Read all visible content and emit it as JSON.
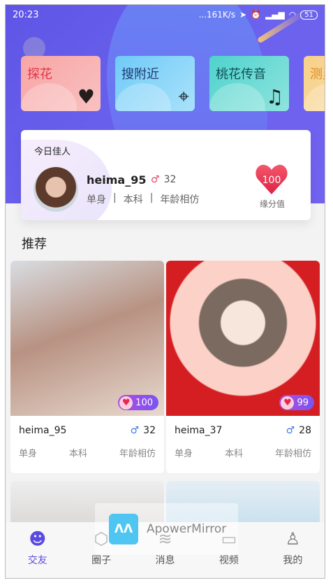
{
  "status": {
    "time": "20:23",
    "speed": "...161K/s",
    "battery": "51"
  },
  "categories": [
    {
      "label": "探花",
      "color": "#e0344a",
      "bg": "linear-gradient(135deg,#f7a5a5,#f9c1c0)"
    },
    {
      "label": "搜附近",
      "color": "#1d3a72",
      "bg": "linear-gradient(135deg,#6fcaf7,#a9e2fb)"
    },
    {
      "label": "桃花传音",
      "color": "#0d4f54",
      "bg": "linear-gradient(135deg,#4fd2cc,#8fe4de)"
    },
    {
      "label": "测灵魂",
      "color": "#e08a1c",
      "bg": "linear-gradient(135deg,#f7d08a,#fae0a8)"
    }
  ],
  "today": {
    "title": "今日佳人",
    "name": "heima_95",
    "age": "32",
    "tags": [
      "单身",
      "本科",
      "年龄相仿"
    ],
    "score": "100",
    "score_label": "缘分值"
  },
  "recommend_title": "推荐",
  "users": [
    {
      "name": "heima_95",
      "age": "32",
      "score": "100",
      "tags": [
        "单身",
        "本科",
        "年龄相仿"
      ],
      "bg": "linear-gradient(160deg,#d8dde2,#b89282 45%,#e8d9cf)"
    },
    {
      "name": "heima_37",
      "age": "28",
      "score": "99",
      "tags": [
        "单身",
        "本科",
        "年龄相仿"
      ],
      "bg": "radial-gradient(circle at 50% 40%,#f6e6dc 0 18%,#7a6a60 19% 36%,#fbd1c8 37% 60%,#d51e22 61%)"
    },
    {
      "bg": "linear-gradient(180deg,#eee,#c9c3bf)"
    },
    {
      "bg": "linear-gradient(180deg,#e6eef5,#a9d3e6)"
    }
  ],
  "nav": [
    {
      "label": "交友",
      "icon": "☻"
    },
    {
      "label": "圈子",
      "icon": "⬡"
    },
    {
      "label": "消息",
      "icon": "≋"
    },
    {
      "label": "视频",
      "icon": "▭"
    },
    {
      "label": "我的",
      "icon": "♙"
    }
  ],
  "watermark": "ApowerMirror"
}
